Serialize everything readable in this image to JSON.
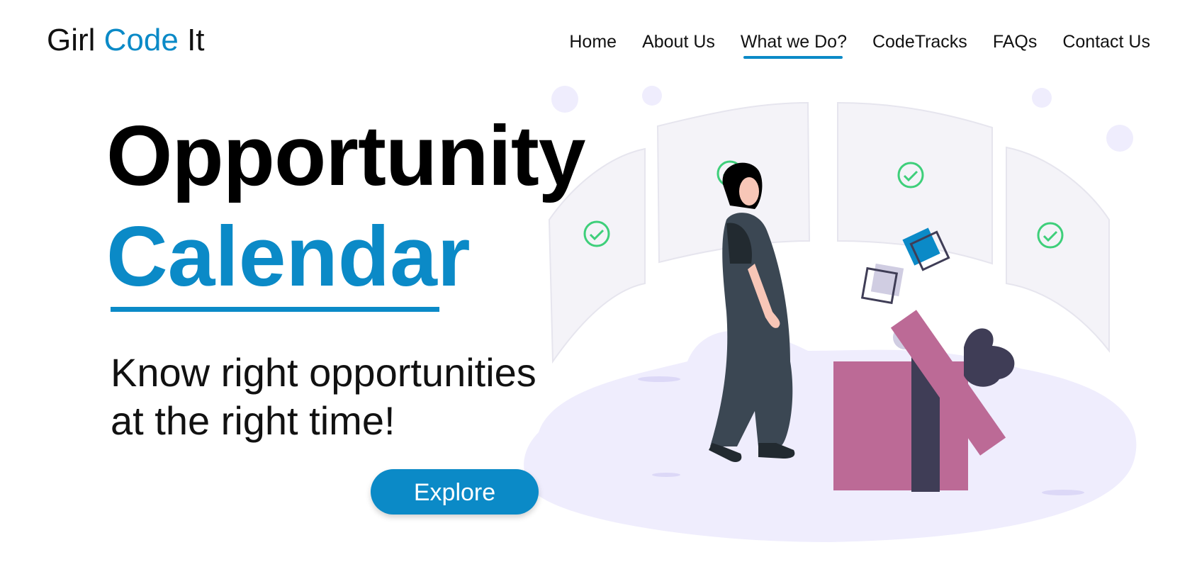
{
  "header": {
    "logo": {
      "part1": "Girl ",
      "part2": "Code",
      "part3": " It"
    },
    "nav": [
      {
        "label": "Home",
        "active": false
      },
      {
        "label": "About Us",
        "active": false
      },
      {
        "label": "What we Do?",
        "active": true
      },
      {
        "label": "CodeTracks",
        "active": false
      },
      {
        "label": "FAQs",
        "active": false
      },
      {
        "label": "Contact Us",
        "active": false
      }
    ]
  },
  "hero": {
    "title_line1": "Opportunity",
    "title_line2": "Calendar",
    "tagline_line1": "Know right opportunities",
    "tagline_line2": "at the right time!",
    "cta_label": "Explore"
  },
  "colors": {
    "accent": "#0b8ac7",
    "text": "#111111",
    "gift_box": "#bc6a96",
    "dark_ribbon": "#3f3d56",
    "blob": "#efedfd",
    "check": "#3ecf7a"
  },
  "illustration": {
    "icons": [
      "check-icon",
      "check-icon",
      "check-icon",
      "check-icon",
      "gift-box-icon",
      "woman-figure",
      "floating-square-icon"
    ]
  }
}
